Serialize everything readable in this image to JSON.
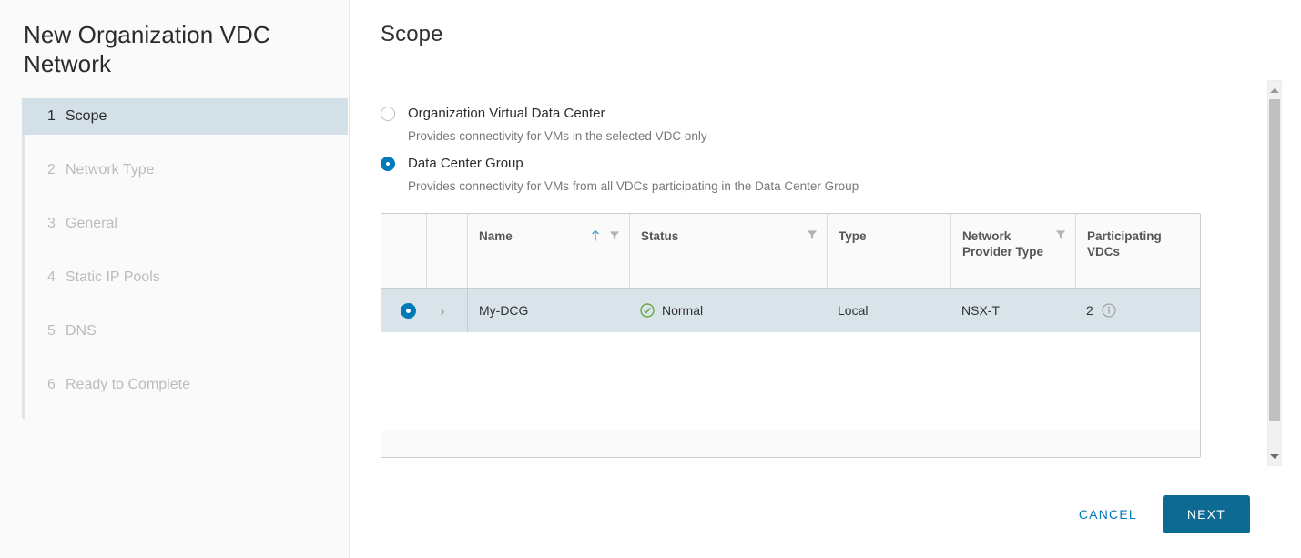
{
  "wizard": {
    "title": "New Organization VDC Network",
    "steps": [
      {
        "num": "1",
        "label": "Scope",
        "state": "active"
      },
      {
        "num": "2",
        "label": "Network Type",
        "state": "disabled"
      },
      {
        "num": "3",
        "label": "General",
        "state": "disabled"
      },
      {
        "num": "4",
        "label": "Static IP Pools",
        "state": "disabled"
      },
      {
        "num": "5",
        "label": "DNS",
        "state": "disabled"
      },
      {
        "num": "6",
        "label": "Ready to Complete",
        "state": "disabled"
      }
    ]
  },
  "page": {
    "title": "Scope"
  },
  "scope_options": [
    {
      "label": "Organization Virtual Data Center",
      "description": "Provides connectivity for VMs in the selected VDC only",
      "selected": false
    },
    {
      "label": "Data Center Group",
      "description": "Provides connectivity for VMs from all VDCs participating in the Data Center Group",
      "selected": true
    }
  ],
  "datagrid": {
    "columns": [
      {
        "key": "select",
        "label": "",
        "sort": "",
        "filter": false
      },
      {
        "key": "expand",
        "label": "",
        "sort": "",
        "filter": false
      },
      {
        "key": "name",
        "label": "Name",
        "sort": "asc",
        "filter": true
      },
      {
        "key": "status",
        "label": "Status",
        "sort": "",
        "filter": true
      },
      {
        "key": "type",
        "label": "Type",
        "sort": "",
        "filter": false
      },
      {
        "key": "npt",
        "label": "Network Provider Type",
        "sort": "",
        "filter": true
      },
      {
        "key": "vdcs",
        "label": "Participating VDCs",
        "sort": "",
        "filter": false
      }
    ],
    "rows": [
      {
        "selected": true,
        "name": "My-DCG",
        "status": "Normal",
        "status_icon": "check-circle-icon",
        "type": "Local",
        "network_provider_type": "NSX-T",
        "participating_vdcs": "2",
        "participating_vdcs_icon": "info-circle-icon"
      }
    ]
  },
  "scrollbar": {
    "up_icon": "caret-up-icon",
    "down_icon": "caret-down-icon"
  },
  "footer": {
    "cancel_label": "CANCEL",
    "next_label": "NEXT"
  },
  "colors": {
    "accent": "#0079b8",
    "primary_button": "#0c6a93",
    "active_step_bg": "#d4e0e7",
    "selected_row_bg": "#d9e4ea",
    "status_ok": "#5aa02c"
  }
}
